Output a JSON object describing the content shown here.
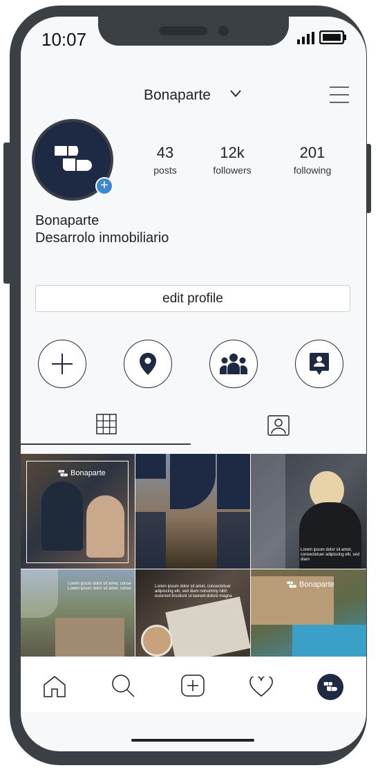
{
  "status_bar": {
    "time": "10:07"
  },
  "header": {
    "username": "Bonaparte"
  },
  "profile": {
    "stats": [
      {
        "value": "43",
        "label": "posts"
      },
      {
        "value": "12k",
        "label": "followers"
      },
      {
        "value": "201",
        "label": "following"
      }
    ],
    "name": "Bonaparte",
    "bio": "Desarrolo inmobiliario",
    "edit_label": "edit profile"
  },
  "highlights": [
    "plus-icon",
    "location-pin-icon",
    "group-icon",
    "contact-card-icon"
  ],
  "grid": {
    "brand": "Bonaparte",
    "lorem_a": "Lorem ipsum dolor sit amet,",
    "lorem_b": "consectetuer adipiscing elit, sed diam",
    "lorem_c": "Lorem ipsum dolor sit amet, conse",
    "lorem_d": "Lorem ipsum dolor sit amet, conse",
    "lorem_e": "Lorem ipsum dolor sit amet, consectetuer",
    "lorem_f": "adipiscing elit, sed diam nonummy nibh",
    "lorem_g": "euismod tincidunt ut laoreet dolore magna"
  },
  "colors": {
    "navy": "#1e2a44",
    "frame": "#3b4045",
    "accent": "#3b87d2"
  }
}
